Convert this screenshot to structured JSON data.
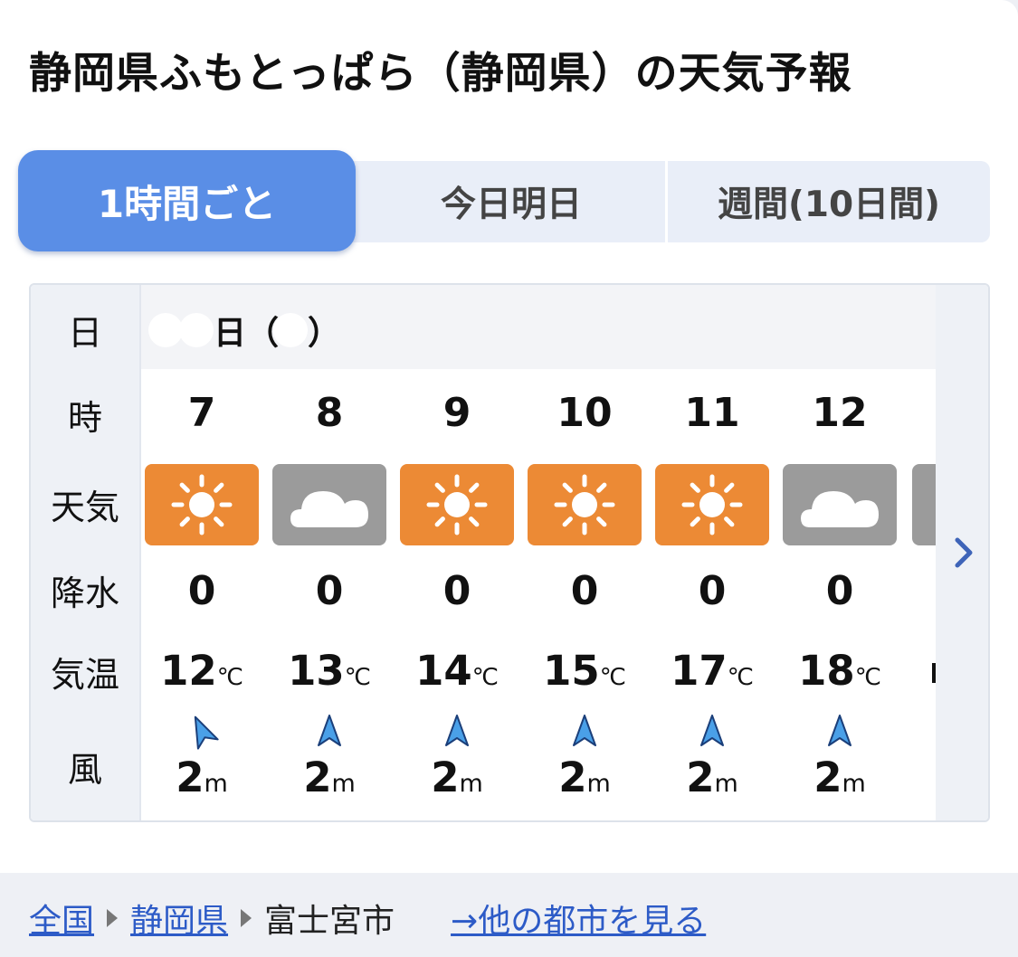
{
  "page": {
    "title": "静岡県ふもとっぱら（静岡県）の天気予報"
  },
  "tabs": [
    {
      "label": "1時間ごと",
      "active": true
    },
    {
      "label": "今日明日",
      "active": false
    },
    {
      "label": "週間(10日間)",
      "active": false
    }
  ],
  "forecast": {
    "row_labels": {
      "date": "日",
      "hour": "時",
      "weather": "天気",
      "precip": "降水",
      "temp": "気温",
      "wind": "風"
    },
    "date_day": "日",
    "date_open": "（",
    "date_close": "）",
    "temp_unit": "℃",
    "wind_unit": "m",
    "hours": [
      {
        "hour": "7",
        "weather": "sunny-icon",
        "precip": "0",
        "temp": "12",
        "wind": "2"
      },
      {
        "hour": "8",
        "weather": "cloudy-icon",
        "precip": "0",
        "temp": "13",
        "wind": "2"
      },
      {
        "hour": "9",
        "weather": "sunny-icon",
        "precip": "0",
        "temp": "14",
        "wind": "2"
      },
      {
        "hour": "10",
        "weather": "sunny-icon",
        "precip": "0",
        "temp": "15",
        "wind": "2"
      },
      {
        "hour": "11",
        "weather": "sunny-icon",
        "precip": "0",
        "temp": "17",
        "wind": "2"
      },
      {
        "hour": "12",
        "weather": "cloudy-icon",
        "precip": "0",
        "temp": "18",
        "wind": "2"
      }
    ],
    "colors": {
      "sunny": "#ec8a35",
      "cloudy": "#9b9b9b",
      "wind_arrow": "#4aa0e8",
      "active_tab": "#5a8ee6",
      "link": "#2d5bc7"
    }
  },
  "breadcrumb": {
    "items": [
      "全国",
      "静岡県",
      "富士宮市"
    ],
    "other_cities": "→他の都市を見る"
  }
}
